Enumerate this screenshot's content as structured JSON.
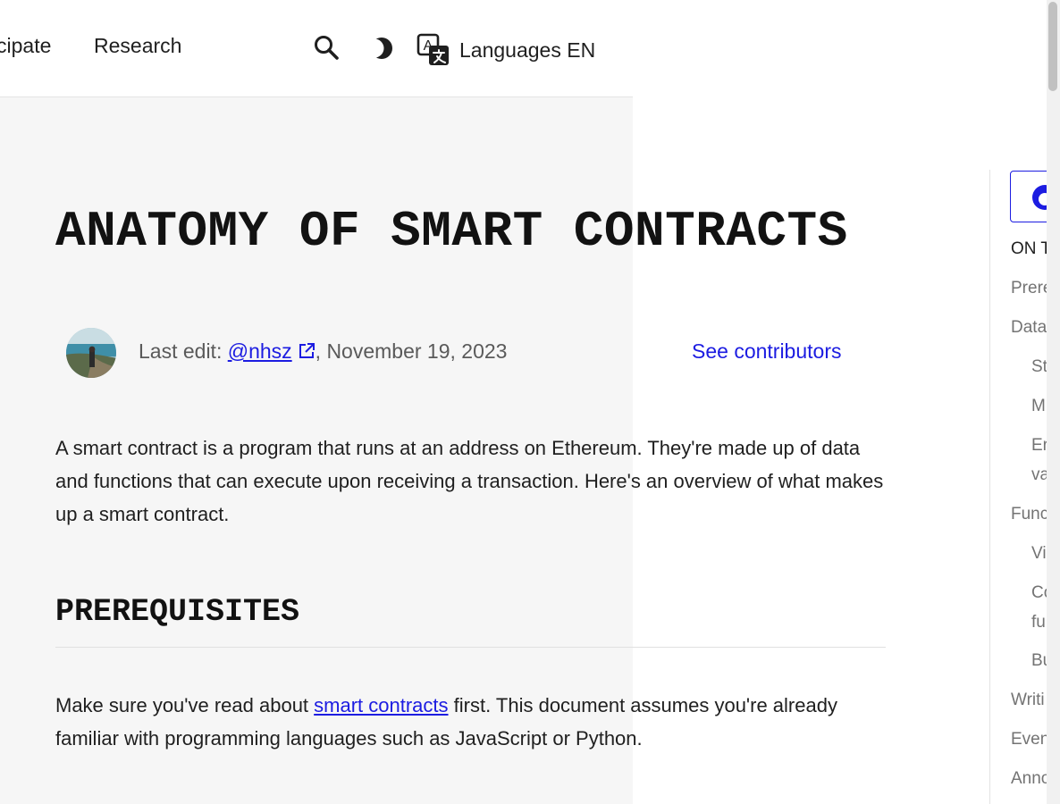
{
  "header": {
    "nav_participate": "cipate",
    "nav_research": "Research",
    "languages_label": "Languages EN"
  },
  "article": {
    "title": "ANATOMY OF SMART CONTRACTS",
    "last_edit_prefix": "Last edit: ",
    "author": "@nhsz",
    "last_edit_date": ", November 19, 2023",
    "see_contributors": "See contributors",
    "intro": "A smart contract is a program that runs at an address on Ethereum. They're made up of data and functions that can execute upon receiving a transaction. Here's an overview of what makes up a smart contract.",
    "prereq_heading": "PREREQUISITES",
    "prereq_before": "Make sure you've read about ",
    "prereq_link": "smart contracts",
    "prereq_after": " first. This document assumes you're already familiar with programming languages such as JavaScript or Python."
  },
  "toc": {
    "title": "ON T",
    "items": [
      {
        "label": "Prere"
      },
      {
        "label": "Data"
      },
      {
        "label": "St"
      },
      {
        "label": "M"
      },
      {
        "label": "Er"
      },
      {
        "label": "va"
      },
      {
        "label": "Func"
      },
      {
        "label": "Vi"
      },
      {
        "label": "Co"
      },
      {
        "label": "fu"
      },
      {
        "label": "Bu"
      },
      {
        "label": "Writi"
      },
      {
        "label": "Even"
      },
      {
        "label": "Anno"
      }
    ]
  },
  "colors": {
    "link": "#1c1ce1",
    "content_bg": "#f6f6f6"
  },
  "icons": [
    "search-icon",
    "moon-icon",
    "translate-icon",
    "external-link-icon",
    "github-icon"
  ]
}
